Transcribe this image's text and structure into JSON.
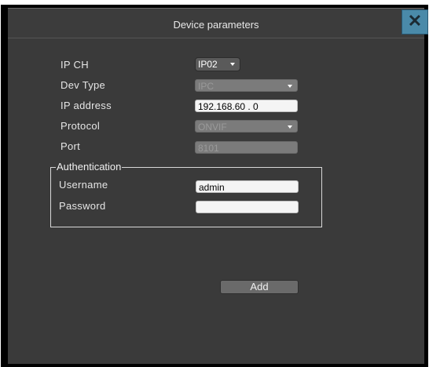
{
  "window": {
    "title": "Device parameters",
    "close_icon": "close-icon"
  },
  "form": {
    "ip_ch": {
      "label": "IP CH",
      "value": "IP02"
    },
    "dev_type": {
      "label": "Dev Type",
      "value": "IPC"
    },
    "ip_address": {
      "label": "IP address",
      "value": "192.168.60 . 0"
    },
    "protocol": {
      "label": "Protocol",
      "value": "ONVIF"
    },
    "port": {
      "label": "Port",
      "value": "8101"
    }
  },
  "authentication": {
    "legend": "Authentication",
    "username": {
      "label": "Username",
      "value": "admin"
    },
    "password": {
      "label": "Password",
      "value": ""
    }
  },
  "actions": {
    "add_label": "Add"
  },
  "colors": {
    "panel": "#3a3a3a",
    "close_button": "#4a8aa9"
  }
}
